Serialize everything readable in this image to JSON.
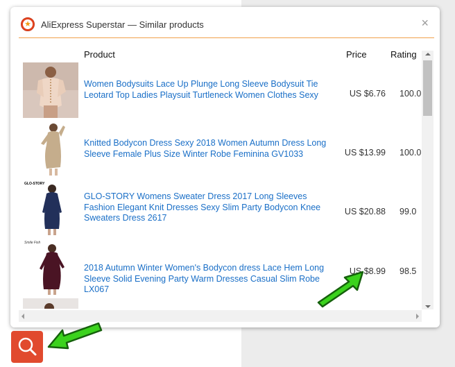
{
  "popup": {
    "title": "AliExpress Superstar — Similar products",
    "close_label": "×"
  },
  "table": {
    "headers": {
      "product": "Product",
      "price": "Price",
      "rating": "Rating"
    },
    "rows": [
      {
        "title": "Women Bodysuits Lace Up Plunge Long Sleeve Bodysuit Tie Leotard Top Ladies Playsuit Turtleneck Women Clothes Sexy",
        "price": "US $6.76",
        "rating": "100.0"
      },
      {
        "title": "Knitted Bodycon Dress Sexy 2018 Women Autumn Dress Long Sleeve Female Plus Size Winter Robe Feminina GV1033",
        "price": "US $13.99",
        "rating": "100.0"
      },
      {
        "title": "GLO-STORY Womens Sweater Dress 2017 Long Sleeves Fashion Elegant Knit Dresses Sexy Slim Party Bodycon Knee Sweaters Dress 2617",
        "price": "US $20.88",
        "rating": "99.0",
        "thumb_brand": "GLO-STORY"
      },
      {
        "title": "2018 Autumn Winter Women's Bodycon dress Lace Hem Long Sleeve Solid Evening Party Warm Dresses Casual Slim Robe LX067",
        "price": "US $8.99",
        "rating": "98.5",
        "thumb_brand": "Smile Fish"
      }
    ]
  },
  "colors": {
    "accent_orange": "#f0a04b",
    "link_blue": "#1a6fc7",
    "fab_red": "#e14a2e",
    "annotation_green": "#3bd21d"
  },
  "icons": {
    "logo": "star-logo-icon",
    "close": "close-icon",
    "search": "search-icon"
  }
}
